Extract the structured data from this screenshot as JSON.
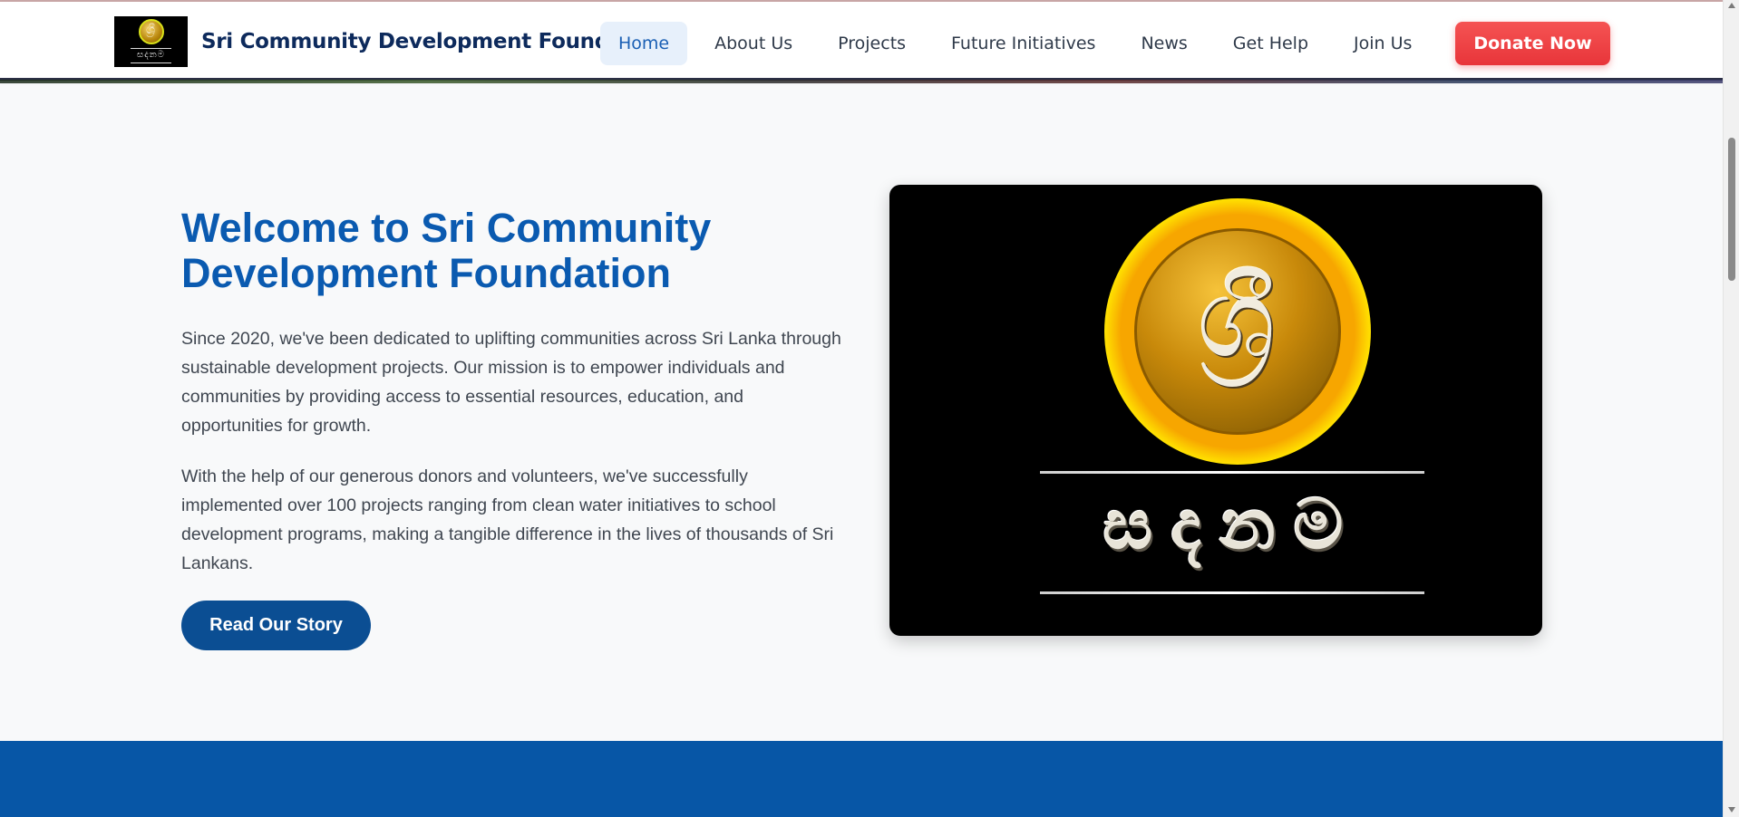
{
  "header": {
    "brand_name": "Sri Community Development Foundation",
    "logo_word": "සදනම",
    "logo_glyph": "ශ්‍රී",
    "nav": [
      {
        "label": "Home",
        "active": true
      },
      {
        "label": "About Us"
      },
      {
        "label": "Projects"
      },
      {
        "label": "Future Initiatives"
      },
      {
        "label": "News"
      },
      {
        "label": "Get Help"
      },
      {
        "label": "Join Us"
      }
    ],
    "donate_label": "Donate Now"
  },
  "hero": {
    "title": "Welcome to Sri Community Development Foundation",
    "paragraph1": "Since 2020, we've been dedicated to uplifting communities across Sri Lanka through sustainable development projects. Our mission is to empower individuals and communities by providing access to essential resources, education, and opportunities for growth.",
    "paragraph2": "With the help of our generous donors and volunteers, we've successfully implemented over 100 projects ranging from clean water initiatives to school development programs, making a tangible difference in the lives of thousands of Sri Lankans.",
    "cta_label": "Read Our Story",
    "image_glyph": "ශ්‍රී",
    "image_word": "සදනම"
  },
  "colors": {
    "primary": "#0a5ab0",
    "nav_active": "#1a5fb4",
    "donate": "#e8353a",
    "cta": "#0b4e93",
    "band": "#0756a6"
  }
}
